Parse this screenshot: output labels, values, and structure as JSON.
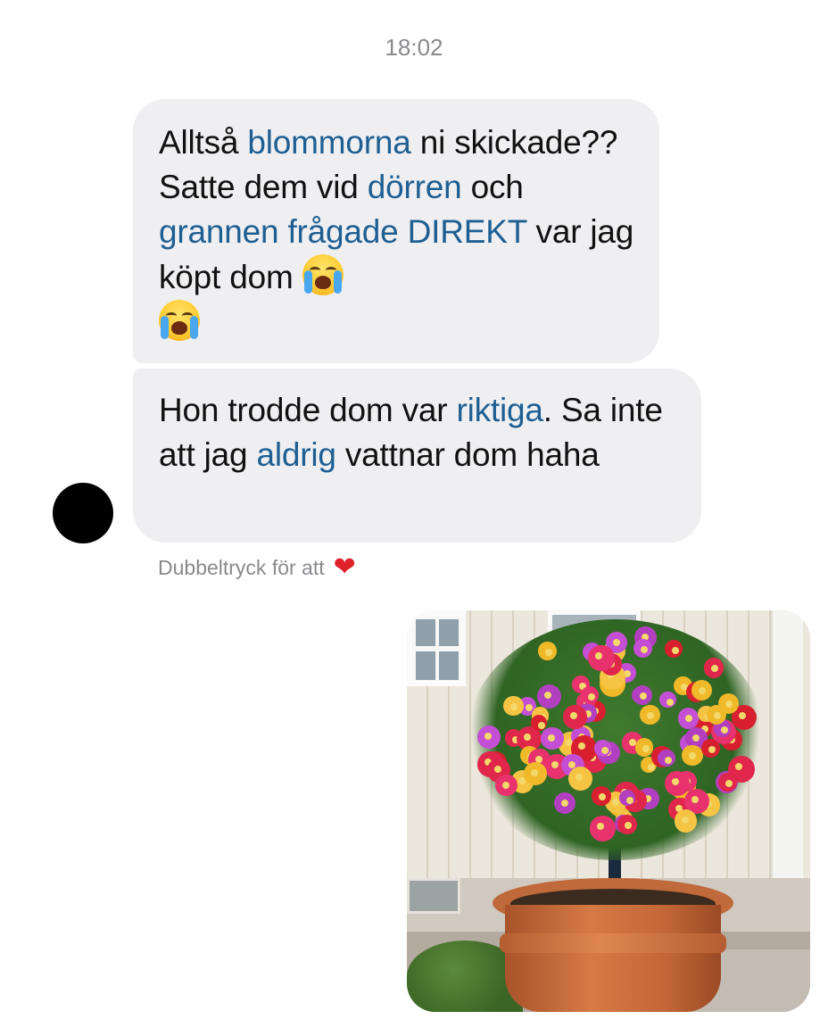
{
  "timestamp": "18:02",
  "messages": [
    {
      "id": "msg1",
      "segments": [
        "Alltså ",
        "blommorna",
        " ni skickade?? Satte dem vid ",
        "dörren",
        " och ",
        "grannen frågade DIREKT",
        " var jag köpt dom "
      ],
      "emoji": [
        "loudly-crying-face",
        "loudly-crying-face"
      ]
    },
    {
      "id": "msg2",
      "segments": [
        "Hon trodde dom var ",
        "riktiga",
        ". Sa inte att jag ",
        "aldrig",
        " vattnar dom haha"
      ]
    }
  ],
  "reaction_hint": {
    "text": "Dubbeltryck för att",
    "icon": "heart-icon",
    "heart_color": "#e0202b"
  },
  "attachment": {
    "type": "photo",
    "subject": "flower-tree-in-terracotta-pot"
  },
  "colors": {
    "bubble_bg": "#efeff1",
    "highlight_text": "#1e5f93",
    "meta_text": "#8a8a8e"
  }
}
